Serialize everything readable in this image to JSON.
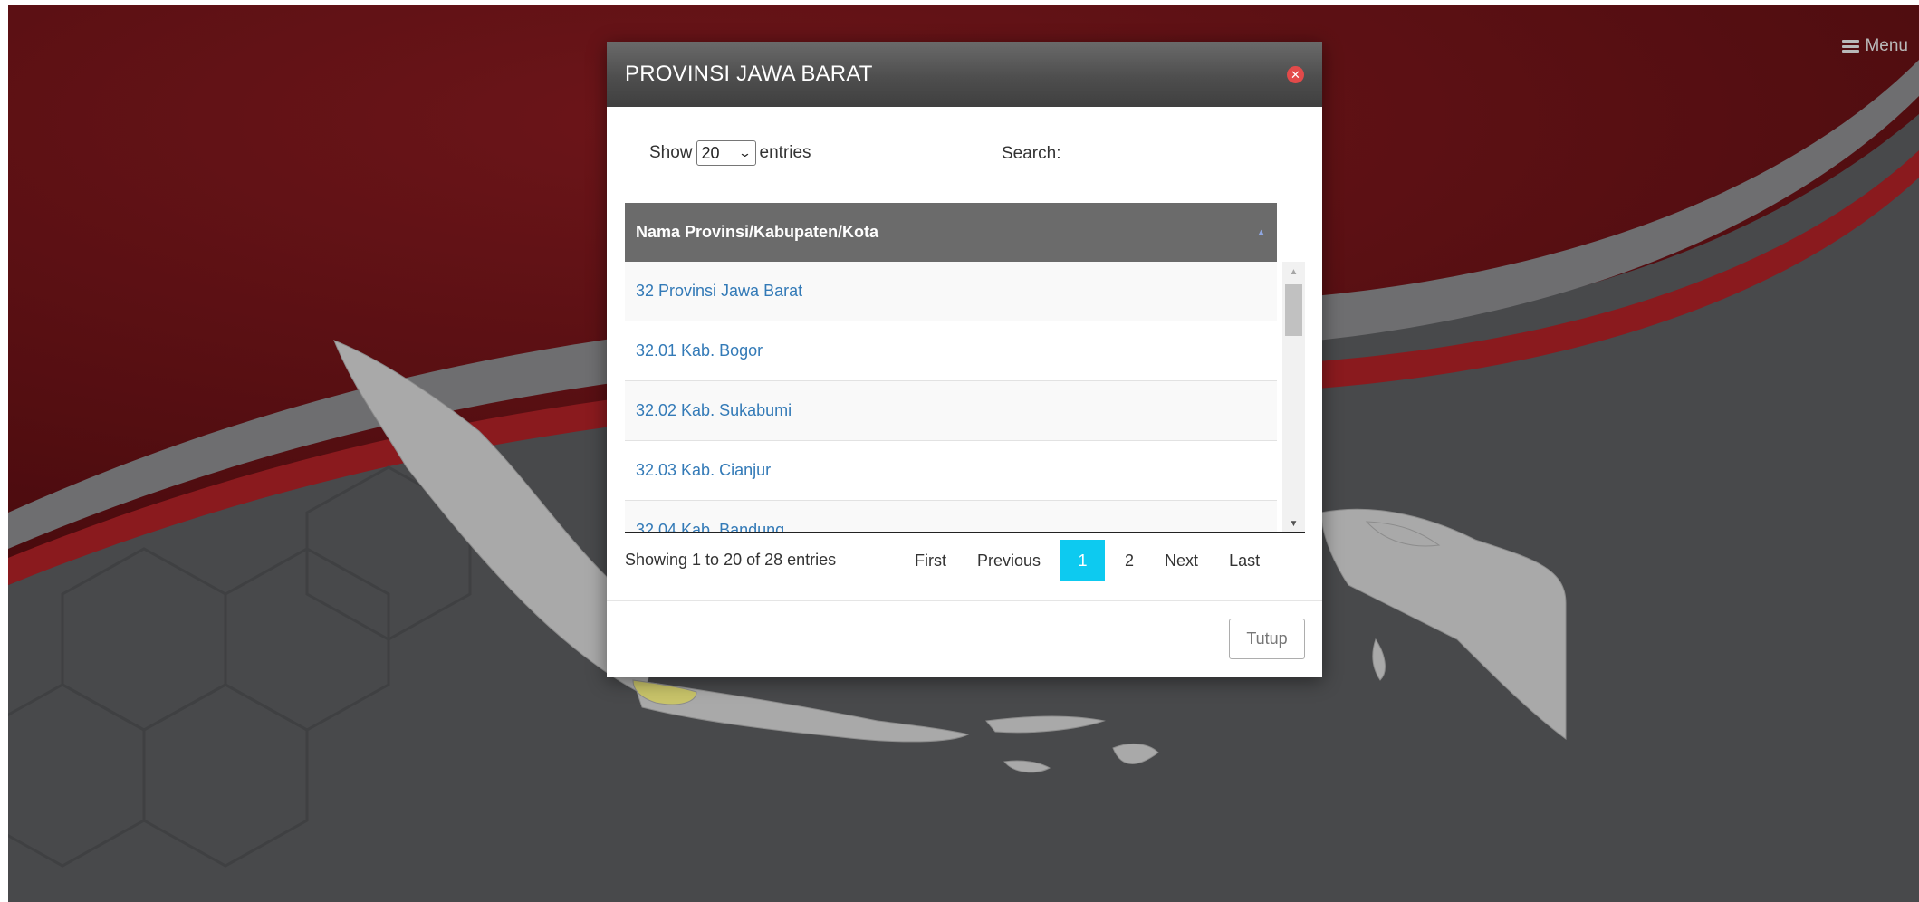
{
  "header": {
    "menu_label": "Menu"
  },
  "modal": {
    "title": "PROVINSI JAWA BARAT",
    "show_label": "Show",
    "page_size": "20",
    "entries_label": "entries",
    "search_label": "Search:",
    "search_value": "",
    "table": {
      "column_header": "Nama Provinsi/Kabupaten/Kota",
      "rows": [
        "32 Provinsi Jawa Barat",
        "32.01 Kab. Bogor",
        "32.02 Kab. Sukabumi",
        "32.03 Kab. Cianjur",
        "32.04 Kab. Bandung"
      ]
    },
    "info": "Showing 1 to 20 of 28 entries",
    "pagination": {
      "first": "First",
      "previous": "Previous",
      "pages": [
        "1",
        "2"
      ],
      "next": "Next",
      "last": "Last"
    },
    "close_button": "Tutup"
  },
  "colors": {
    "header_bar": "#4e4e4e",
    "table_header": "#6b6b6b",
    "link": "#337ab7",
    "active_page": "#0dcaf0",
    "close_icon": "#e34a4a",
    "background_red": "#7a1418",
    "map_land": "#a9a9a9",
    "highlight_province": "#c9c46a"
  }
}
